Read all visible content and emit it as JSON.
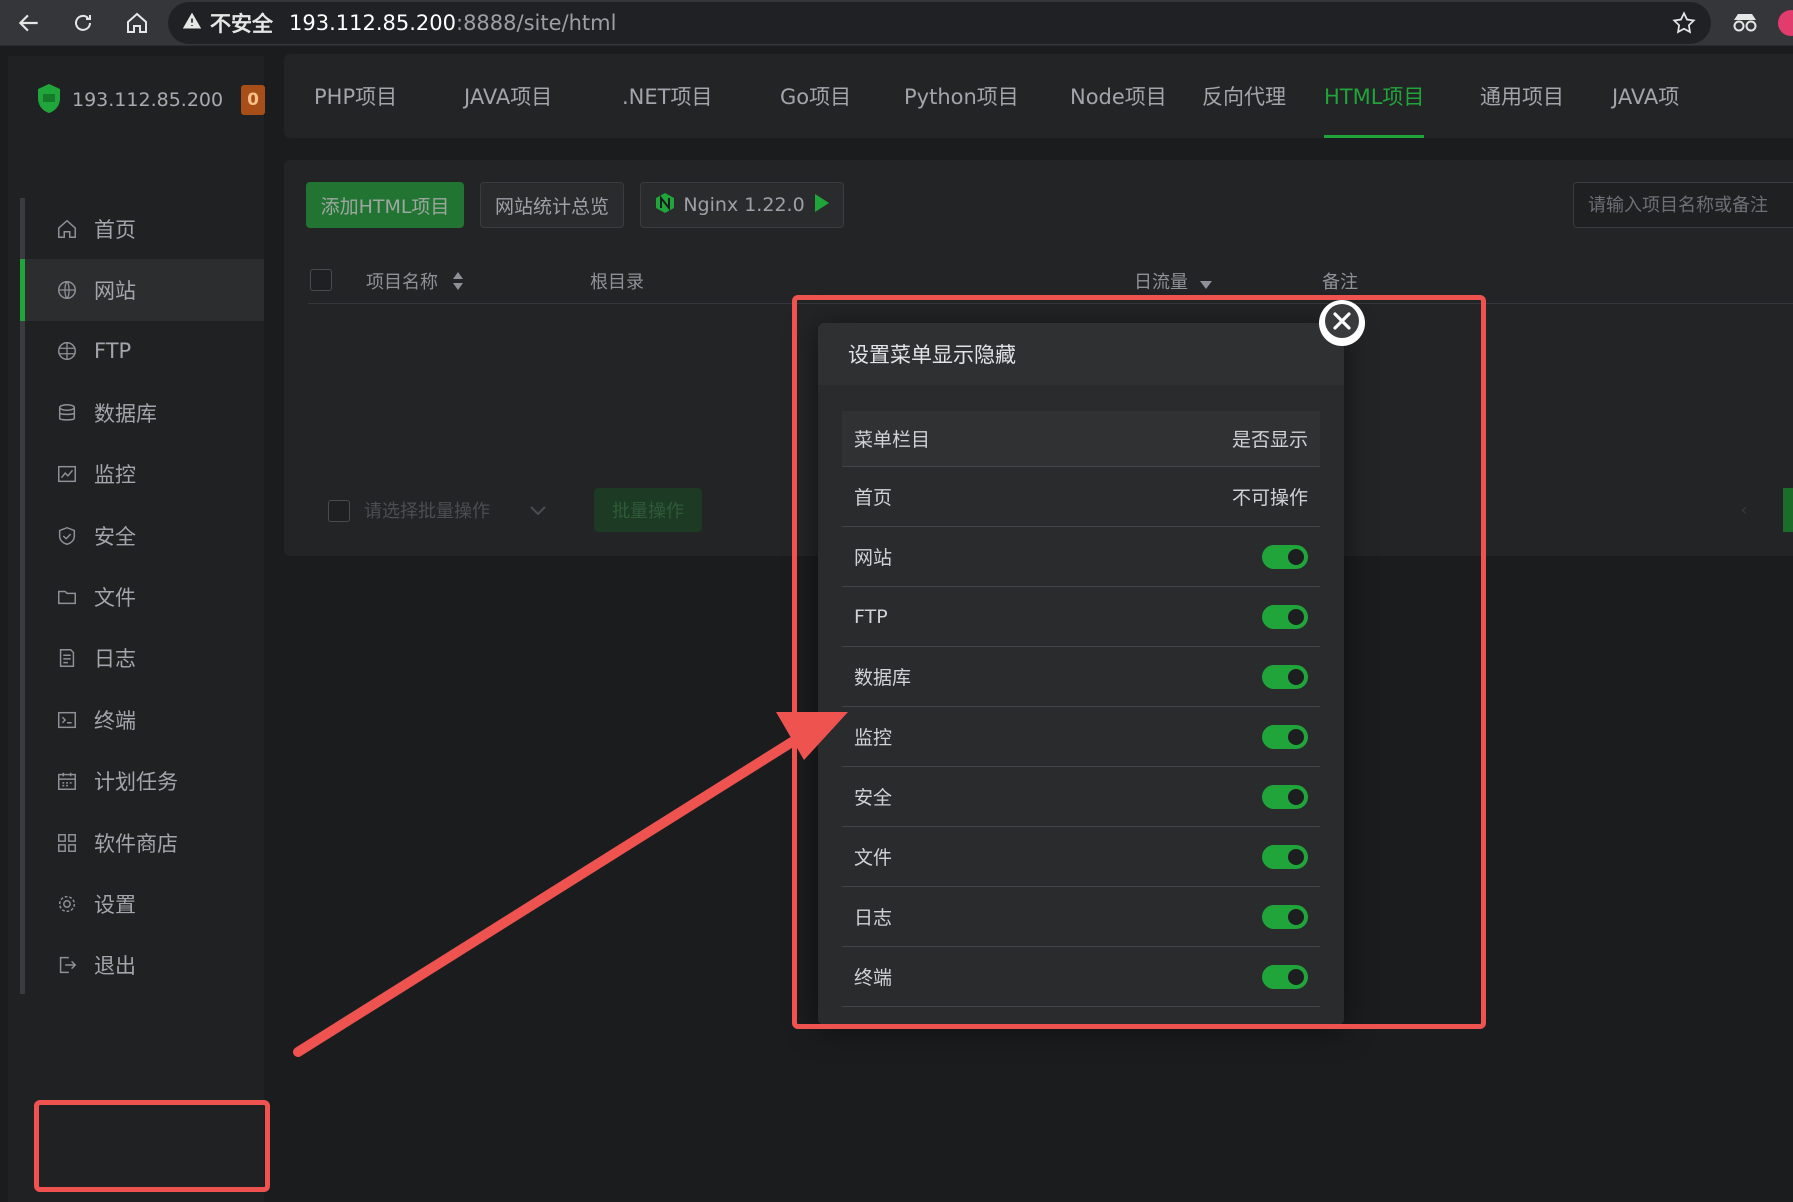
{
  "browser": {
    "security_label": "不安全",
    "url_host": "193.112.85.200",
    "url_path": ":8888/site/html"
  },
  "sidebar": {
    "server_ip": "193.112.85.200",
    "badge_count": "0",
    "items": [
      {
        "label": "首页",
        "icon": "home-icon"
      },
      {
        "label": "网站",
        "icon": "globe-icon"
      },
      {
        "label": "FTP",
        "icon": "ftp-globe-icon"
      },
      {
        "label": "数据库",
        "icon": "database-icon"
      },
      {
        "label": "监控",
        "icon": "monitor-chart-icon"
      },
      {
        "label": "安全",
        "icon": "shield-icon"
      },
      {
        "label": "文件",
        "icon": "folder-icon"
      },
      {
        "label": "日志",
        "icon": "log-document-icon"
      },
      {
        "label": "终端",
        "icon": "terminal-icon"
      },
      {
        "label": "计划任务",
        "icon": "calendar-task-icon"
      },
      {
        "label": "软件商店",
        "icon": "app-store-grid-icon"
      },
      {
        "label": "设置",
        "icon": "gear-icon"
      },
      {
        "label": "退出",
        "icon": "logout-icon"
      }
    ],
    "active_index": 1
  },
  "tabs": [
    "PHP项目",
    "JAVA项目",
    ".NET项目",
    "Go项目",
    "Python项目",
    "Node项目",
    "反向代理",
    "HTML项目",
    "通用项目",
    "JAVA项"
  ],
  "active_tab": "HTML项目",
  "toolbar": {
    "add_button": "添加HTML项目",
    "stats_button": "网站统计总览",
    "nginx_label": "Nginx 1.22.0",
    "search_placeholder": "请输入项目名称或备注"
  },
  "table": {
    "col_name": "项目名称",
    "col_root": "根目录",
    "col_traffic": "日流量",
    "col_remark": "备注"
  },
  "batch": {
    "select_placeholder": "请选择批量操作",
    "button": "批量操作"
  },
  "modal": {
    "title": "设置菜单显示隐藏",
    "header_col1": "菜单栏目",
    "header_col2": "是否显示",
    "rows": [
      {
        "label": "首页",
        "value": "不可操作",
        "toggle": null
      },
      {
        "label": "网站",
        "value": null,
        "toggle": true
      },
      {
        "label": "FTP",
        "value": null,
        "toggle": true
      },
      {
        "label": "数据库",
        "value": null,
        "toggle": true
      },
      {
        "label": "监控",
        "value": null,
        "toggle": true
      },
      {
        "label": "安全",
        "value": null,
        "toggle": true
      },
      {
        "label": "文件",
        "value": null,
        "toggle": true
      },
      {
        "label": "日志",
        "value": null,
        "toggle": true
      },
      {
        "label": "终端",
        "value": null,
        "toggle": true
      }
    ]
  },
  "colors": {
    "accent_green": "#20a53a",
    "annotation_red": "#ef5350",
    "badge_orange": "#a84e19"
  }
}
